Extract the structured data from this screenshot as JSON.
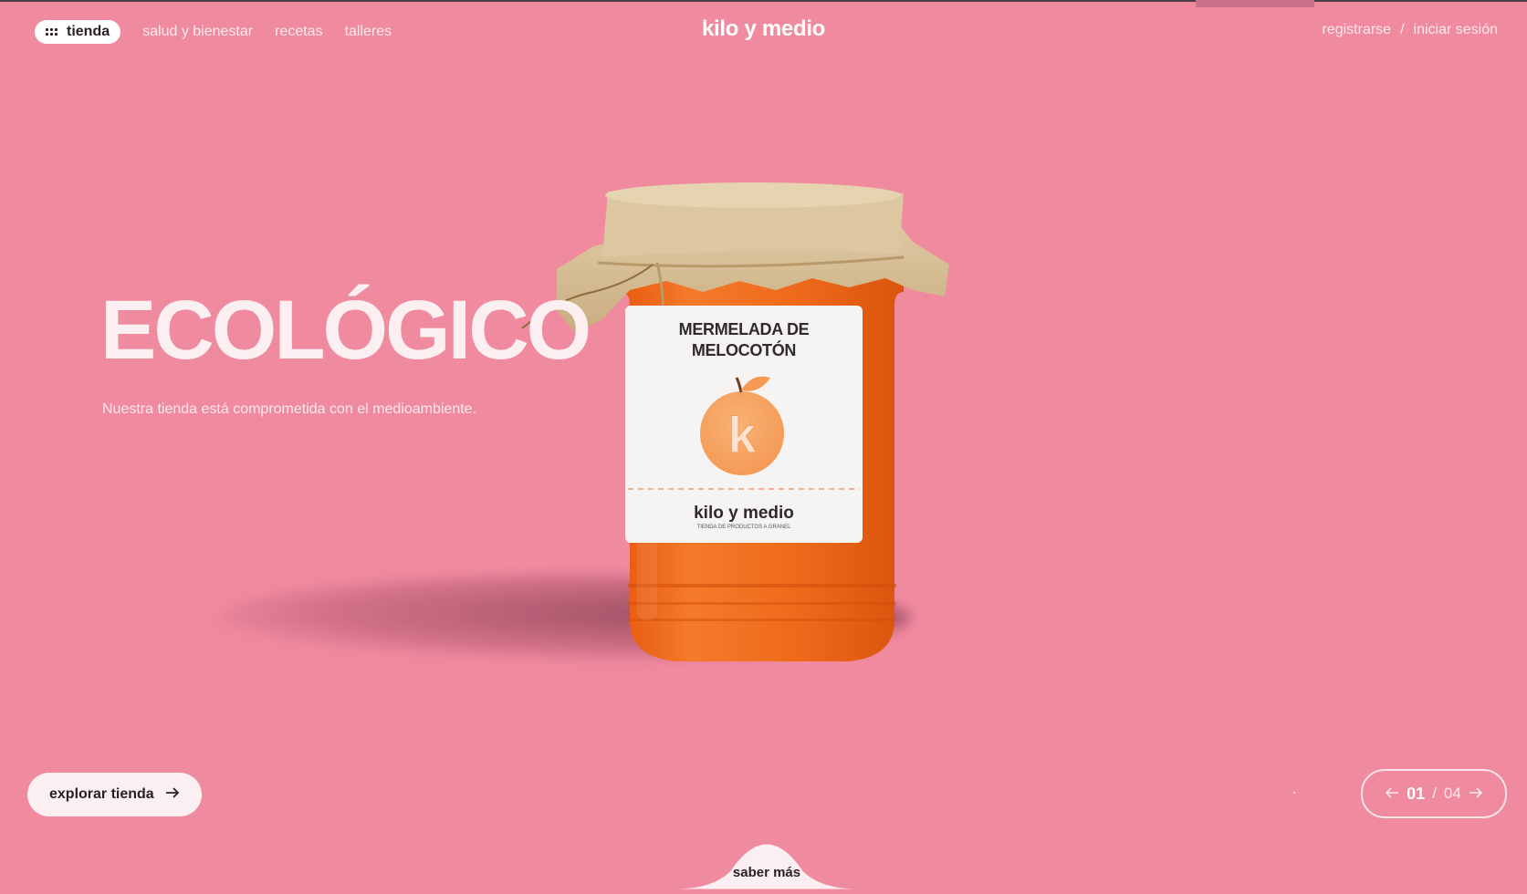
{
  "header": {
    "shop_label": "tienda",
    "nav": [
      "salud y bienestar",
      "recetas",
      "talleres"
    ],
    "brand": "kilo y medio",
    "register": "registrarse",
    "separator": "/",
    "login": "iniciar sesión"
  },
  "hero": {
    "title": "ECOLÓGICO",
    "subtitle": "Nuestra tienda está comprometida con el medioambiente.",
    "product": {
      "label_line1": "MERMELADA DE",
      "label_line2": "MELOCOTÓN",
      "logo_letter": "k",
      "brand": "kilo y medio",
      "tagline": "TIENDA DE PRODUCTOS A GRANEL"
    }
  },
  "cta": {
    "explore_label": "explorar tienda"
  },
  "pager": {
    "current": "01",
    "separator": "/",
    "total": "04"
  },
  "footer": {
    "more_label": "saber más"
  },
  "colors": {
    "background": "#f08a9f",
    "jam": "#f06b1c",
    "cloth": "#d9c39b"
  },
  "icons": [
    "grid-icon",
    "arrow-right-icon",
    "arrow-left-icon"
  ]
}
